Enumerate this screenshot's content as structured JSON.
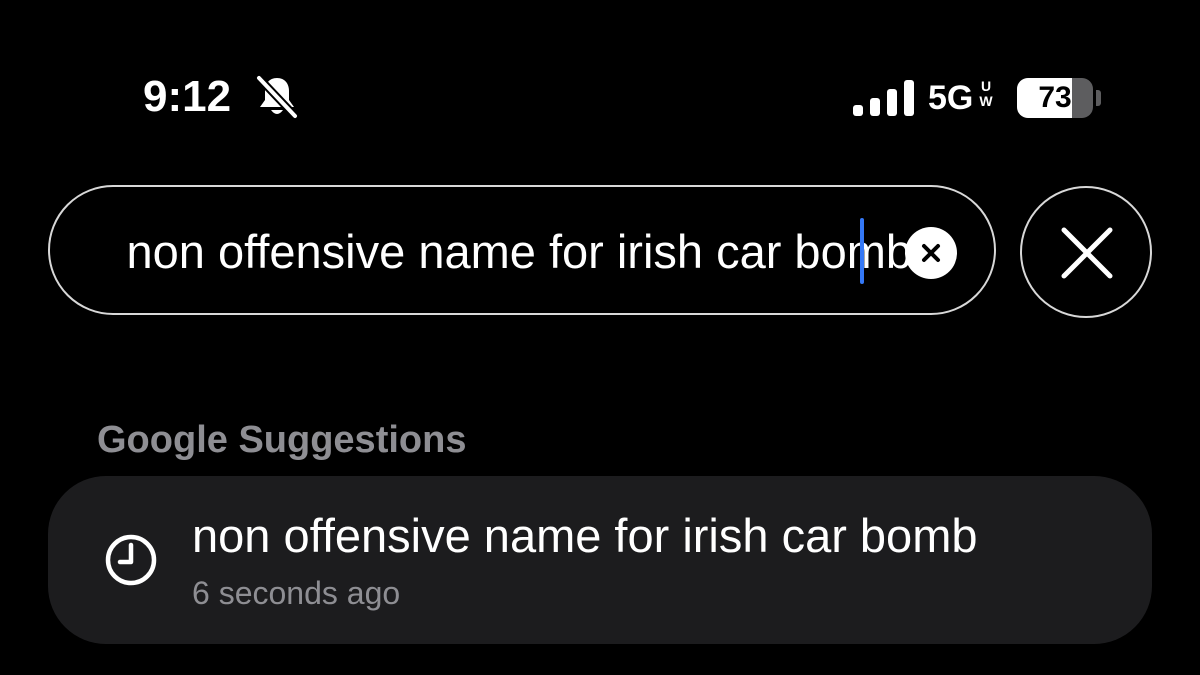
{
  "status_bar": {
    "time": "9:12",
    "bell_icon": "bell-slash-icon",
    "signal_icon": "cellular-signal-icon",
    "network": "5G",
    "network_sub": "UW",
    "battery_level": "73",
    "battery_fraction": 0.73
  },
  "search": {
    "value": "non offensive name for irish car bomb",
    "clear_icon": "clear-x-circle-icon",
    "close_icon": "close-x-icon",
    "caret_color": "#3478f6"
  },
  "suggestions": {
    "heading": "Google Suggestions",
    "items": [
      {
        "icon": "clock-history-icon",
        "title": "non offensive name for irish car bomb",
        "subtitle": "6 seconds ago"
      }
    ]
  }
}
